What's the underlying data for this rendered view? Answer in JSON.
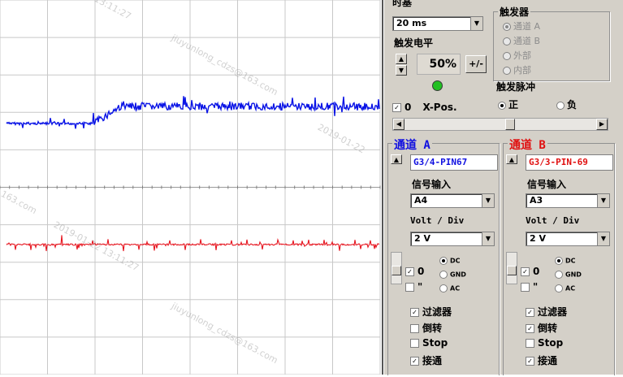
{
  "scope": {
    "colors": {
      "grid": "#c8c8c8",
      "channel_a": "#0a14e6",
      "channel_b": "#e6141e"
    }
  },
  "timebase": {
    "title": "时基",
    "value": "20 ms"
  },
  "trigger": {
    "group_label": "触发器",
    "sources": [
      {
        "label": "通道 A",
        "selected": true
      },
      {
        "label": "通道 B",
        "selected": false
      },
      {
        "label": "外部",
        "selected": false
      },
      {
        "label": "内部",
        "selected": false
      }
    ],
    "level_label": "触发电平",
    "level_value": "50%",
    "plusminus": "+/-",
    "indicator_color": "#22c022",
    "pulse_label": "触发脉冲",
    "pulse_options": [
      {
        "label": "正",
        "selected": true
      },
      {
        "label": "负",
        "selected": false
      }
    ],
    "xpos_checkbox": "✓",
    "xpos_value": "0",
    "xpos_label": "X-Pos."
  },
  "channel_a": {
    "title": "通道 A",
    "color": "#1010e0",
    "name": "G3/4-PIN67",
    "input_label": "信号输入",
    "input_value": "A4",
    "volt_label": "Volt / Div",
    "volt_value": "2 V",
    "offset_value": "0",
    "coupling": [
      {
        "label": "DC",
        "selected": true
      },
      {
        "label": "GND",
        "selected": false
      },
      {
        "label": "AC",
        "selected": false
      }
    ],
    "minus_label": "\"",
    "options": [
      {
        "label": "过滤器",
        "checked": true
      },
      {
        "label": "倒转",
        "checked": false
      },
      {
        "label": "Stop",
        "checked": false
      },
      {
        "label": "接通",
        "checked": true
      }
    ]
  },
  "channel_b": {
    "title": "通道 B",
    "color": "#e01010",
    "name": "G3/3-PIN-69",
    "input_label": "信号输入",
    "input_value": "A3",
    "volt_label": "Volt / Div",
    "volt_value": "2 V",
    "offset_value": "0",
    "coupling": [
      {
        "label": "DC",
        "selected": true
      },
      {
        "label": "GND",
        "selected": false
      },
      {
        "label": "AC",
        "selected": false
      }
    ],
    "minus_label": "\"",
    "options": [
      {
        "label": "过滤器",
        "checked": true
      },
      {
        "label": "倒转",
        "checked": true
      },
      {
        "label": "Stop",
        "checked": false
      },
      {
        "label": "接通",
        "checked": true
      }
    ]
  },
  "watermarks": [
    "13:11:27",
    "jiuyunlong_cdzs@163.com",
    "2019-01-22",
    "163.com",
    "2019-01-22 13:11:27",
    "jiuyunlong_cdzs@163.com"
  ]
}
